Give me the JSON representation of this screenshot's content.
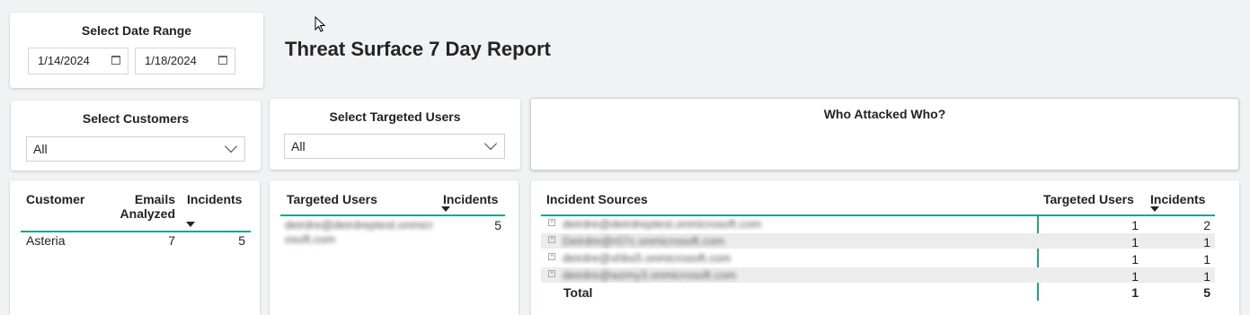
{
  "date_range": {
    "title": "Select Date Range",
    "start": "1/14/2024",
    "end": "1/18/2024"
  },
  "report_title": "Threat Surface 7 Day Report",
  "customers_slicer": {
    "title": "Select Customers",
    "value": "All"
  },
  "users_slicer": {
    "title": "Select Targeted Users",
    "value": "All"
  },
  "who_attacked": {
    "title": "Who Attacked Who?"
  },
  "customer_table": {
    "headers": {
      "customer": "Customer",
      "emails": "Emails Analyzed",
      "incidents": "Incidents"
    },
    "rows": [
      {
        "customer": "Asteria",
        "emails": "7",
        "incidents": "5"
      }
    ]
  },
  "users_table": {
    "headers": {
      "user": "Targeted Users",
      "incidents": "Incidents"
    },
    "rows": [
      {
        "user": "deirdre@deirdreptest.onmicrosoft.com",
        "incidents": "5"
      }
    ]
  },
  "sources_table": {
    "headers": {
      "source": "Incident Sources",
      "users": "Targeted Users",
      "incidents": "Incidents"
    },
    "rows": [
      {
        "source": "deirdre@deirdreptest.onmicrosoft.com",
        "users": "1",
        "incidents": "2"
      },
      {
        "source": "Deirdre@r07c.onmicrosoft.com",
        "users": "1",
        "incidents": "1"
      },
      {
        "source": "deirdre@xhbs5.onmicrosoft.com",
        "users": "1",
        "incidents": "1"
      },
      {
        "source": "deirdre@wzmy3.onmicrosoft.com",
        "users": "1",
        "incidents": "1"
      }
    ],
    "total": {
      "label": "Total",
      "users": "1",
      "incidents": "5"
    }
  }
}
